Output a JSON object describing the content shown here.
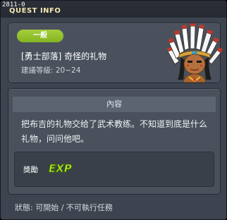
{
  "window": {
    "id": "2811-0",
    "title": "QUEST INFO"
  },
  "quest": {
    "category": "一般",
    "name": "[勇士部落] 奇怪的礼物",
    "level": "建議等級: 20~24",
    "portrait_icon": "native-chief-portrait-icon"
  },
  "content": {
    "header": "內容",
    "description": "把布吉的礼物交给了武术教练。不知道到底是什么礼物，问问他吧。"
  },
  "reward": {
    "label": "獎勵",
    "exp_icon": "exp-icon",
    "exp_text": "EXP"
  },
  "status": "狀態: 可開始 / 不可執行任務",
  "colors": {
    "badge": "#94c22e",
    "title": "#f3e9b0",
    "exp": "#c2f028"
  }
}
